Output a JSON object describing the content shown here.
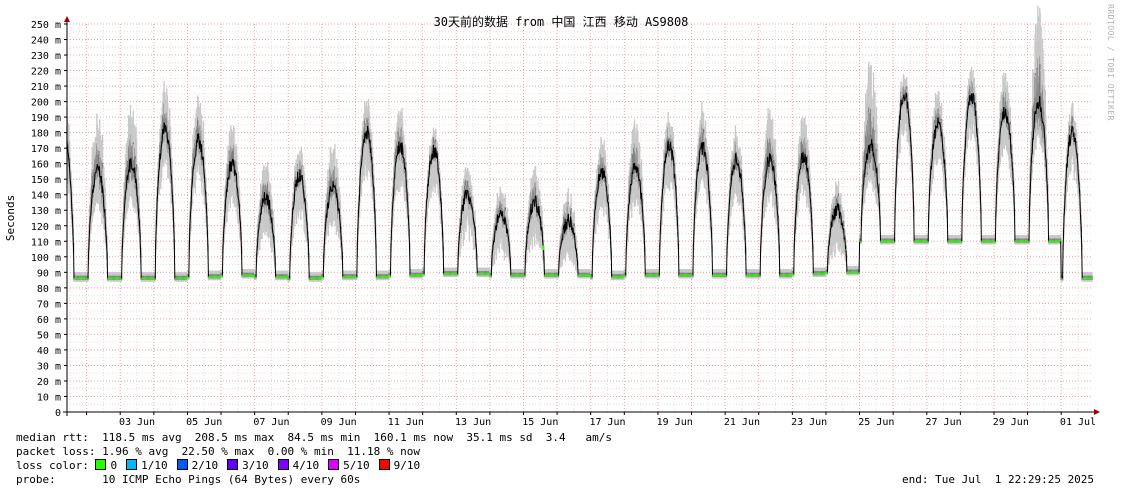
{
  "chart_data": {
    "type": "area",
    "title": "30天前的数据 from 中国 江西 移动 AS9808",
    "ylabel": "Seconds",
    "xlabel": "",
    "ylim": [
      0,
      250
    ],
    "y_unit": "ms",
    "xlim": [
      "2025-06-01 10:00",
      "2025-07-01 22:00"
    ],
    "y_ticks": [
      "0",
      "10 m",
      "20 m",
      "30 m",
      "40 m",
      "50 m",
      "60 m",
      "70 m",
      "80 m",
      "90 m",
      "100 m",
      "110 m",
      "120 m",
      "130 m",
      "140 m",
      "150 m",
      "160 m",
      "170 m",
      "180 m",
      "190 m",
      "200 m",
      "210 m",
      "220 m",
      "230 m",
      "240 m",
      "250 m"
    ],
    "x_ticks": [
      "03 Jun",
      "05 Jun",
      "07 Jun",
      "09 Jun",
      "11 Jun",
      "13 Jun",
      "15 Jun",
      "17 Jun",
      "19 Jun",
      "21 Jun",
      "23 Jun",
      "25 Jun",
      "27 Jun",
      "29 Jun",
      "01 Jul"
    ],
    "grid": true,
    "daily_median_rtt": {
      "dates": [
        "06-01",
        "06-02",
        "06-03",
        "06-04",
        "06-05",
        "06-06",
        "06-07",
        "06-08",
        "06-09",
        "06-10",
        "06-11",
        "06-12",
        "06-13",
        "06-14",
        "06-15",
        "06-16",
        "06-17",
        "06-18",
        "06-19",
        "06-20",
        "06-21",
        "06-22",
        "06-23",
        "06-24",
        "06-25",
        "06-26",
        "06-27",
        "06-28",
        "06-29",
        "06-30",
        "07-01"
      ],
      "base_ms": [
        86,
        86,
        86,
        86,
        87,
        88,
        87,
        86,
        87,
        87,
        88,
        89,
        89,
        88,
        88,
        88,
        87,
        88,
        88,
        88,
        88,
        88,
        89,
        90,
        110,
        110,
        110,
        110,
        110,
        110,
        86
      ],
      "peak_ms": [
        176,
        155,
        160,
        183,
        175,
        160,
        138,
        152,
        145,
        180,
        172,
        168,
        140,
        128,
        135,
        123,
        155,
        158,
        172,
        170,
        162,
        163,
        165,
        130,
        172,
        205,
        185,
        203,
        193,
        200,
        180
      ],
      "max_ms": [
        195,
        185,
        190,
        205,
        195,
        178,
        155,
        165,
        165,
        195,
        188,
        175,
        150,
        140,
        150,
        135,
        170,
        180,
        185,
        190,
        175,
        190,
        185,
        140,
        215,
        215,
        200,
        215,
        210,
        250,
        190
      ]
    },
    "loss_color_legend": [
      {
        "label": "0",
        "color": "#26ff00"
      },
      {
        "label": "1/10",
        "color": "#00b8ff"
      },
      {
        "label": "2/10",
        "color": "#0059ff"
      },
      {
        "label": "3/10",
        "color": "#5e00ff"
      },
      {
        "label": "4/10",
        "color": "#7e00ff"
      },
      {
        "label": "5/10",
        "color": "#dd00ff"
      },
      {
        "label": "9/10",
        "color": "#ff0000"
      }
    ]
  },
  "stats": {
    "median_rtt": "median rtt:  118.5 ms avg  208.5 ms max  84.5 ms min  160.1 ms now  35.1 ms sd  3.4   am/s",
    "packet_loss": "packet loss: 1.96 % avg  22.50 % max  0.00 % min  11.18 % now",
    "loss_color_label": "loss color:",
    "probe": "probe:       10 ICMP Echo Pings (64 Bytes) every 60s",
    "end": "end: Tue Jul  1 22:29:25 2025"
  },
  "watermark": "RRDTOOL / TOBI OETIKER"
}
